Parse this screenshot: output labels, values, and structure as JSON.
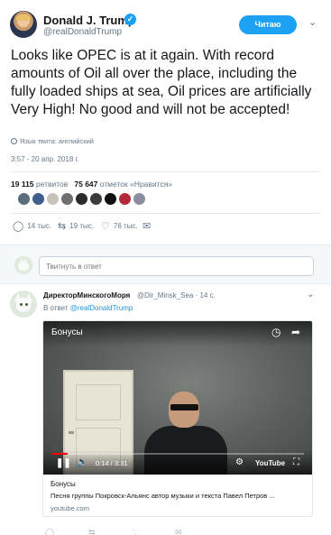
{
  "author": {
    "name": "Donald J. Trump",
    "handle": "@realDonaldTrump",
    "verified_glyph": "✓"
  },
  "follow_button": "Читаю",
  "tweet": {
    "text": "Looks like OPEC is at it again. With record amounts of Oil all over the place, including the fully loaded ships at sea, Oil prices are artificially Very High! No good and will not be accepted!",
    "language": "Язык твита: английский",
    "timestamp": "3:57 - 20 апр. 2018 г."
  },
  "stats": {
    "retweets_count": "19 115",
    "retweets_label": "ретвитов",
    "likes_count": "75 647",
    "likes_label": "отметок «Нравится»"
  },
  "likers": [
    "#5a6b7c",
    "#3f5f8a",
    "#c9c2b8",
    "#6e6e6e",
    "#2b2b2b",
    "#3b3b3b",
    "#111111",
    "#b22a3a",
    "#8a8fa0"
  ],
  "actions": {
    "replies": "14 тыс.",
    "retweets": "19 тыс.",
    "likes": "76 тыс."
  },
  "reply_box": {
    "placeholder": "Твитнуть в ответ"
  },
  "reply": {
    "name": "ДиректорМинскогоМоря",
    "handle_time": "@Dir_Minsk_Sea · 14 с.",
    "in_reply_prefix": "В ответ",
    "in_reply_to": "@realDonaldTrump",
    "video": {
      "title": "Бонусы",
      "time": "0:14 / 3:31",
      "progress": 0.066,
      "brand": "YouTube"
    },
    "card": {
      "title": "Бонусы",
      "description": "Песня группы Покровск-Альянс автор музыки и текста Павел Петров ...",
      "domain": "youtube.com"
    }
  },
  "colors": {
    "accent": "#1da1f2",
    "link": "#1b95e0",
    "muted": "#657786"
  }
}
